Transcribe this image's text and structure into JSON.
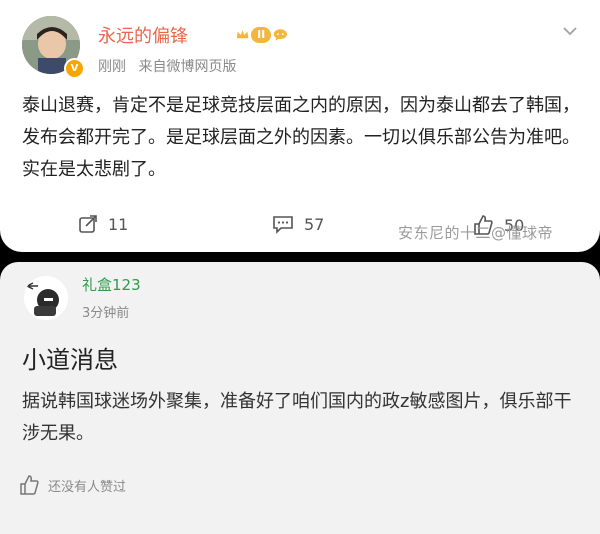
{
  "post": {
    "username": "永远的偏锋",
    "level_badge": "II",
    "verified_badge": "V",
    "time": "刚刚",
    "source": "来自微博网页版",
    "body": "泰山退赛，肯定不是足球竞技层面之内的原因，因为泰山都去了韩国，发布会都开完了。是足球层面之外的因素。一切以俱乐部公告为准吧。实在是太悲剧了。",
    "repost_count": "11",
    "comment_count": "57",
    "like_count": "50",
    "watermark": "安东尼的十二@懂球帝"
  },
  "comment": {
    "username": "礼盒123",
    "time": "3分钟前",
    "title": "小道消息",
    "body": "据说韩国球迷场外聚集，准备好了咱们国内的政z敏感图片，俱乐部干涉无果。",
    "likes_text": "还没有人赞过"
  },
  "colors": {
    "username_orange": "#e8674c",
    "username_green": "#2e9a4e",
    "badge_gold": "#f4b53a"
  },
  "icons": [
    "verified-v-icon",
    "level-crown-icon",
    "chat-bubble-icon",
    "more-chevron-icon",
    "repost-icon",
    "comment-icon",
    "like-icon",
    "thumbs-up-icon"
  ]
}
